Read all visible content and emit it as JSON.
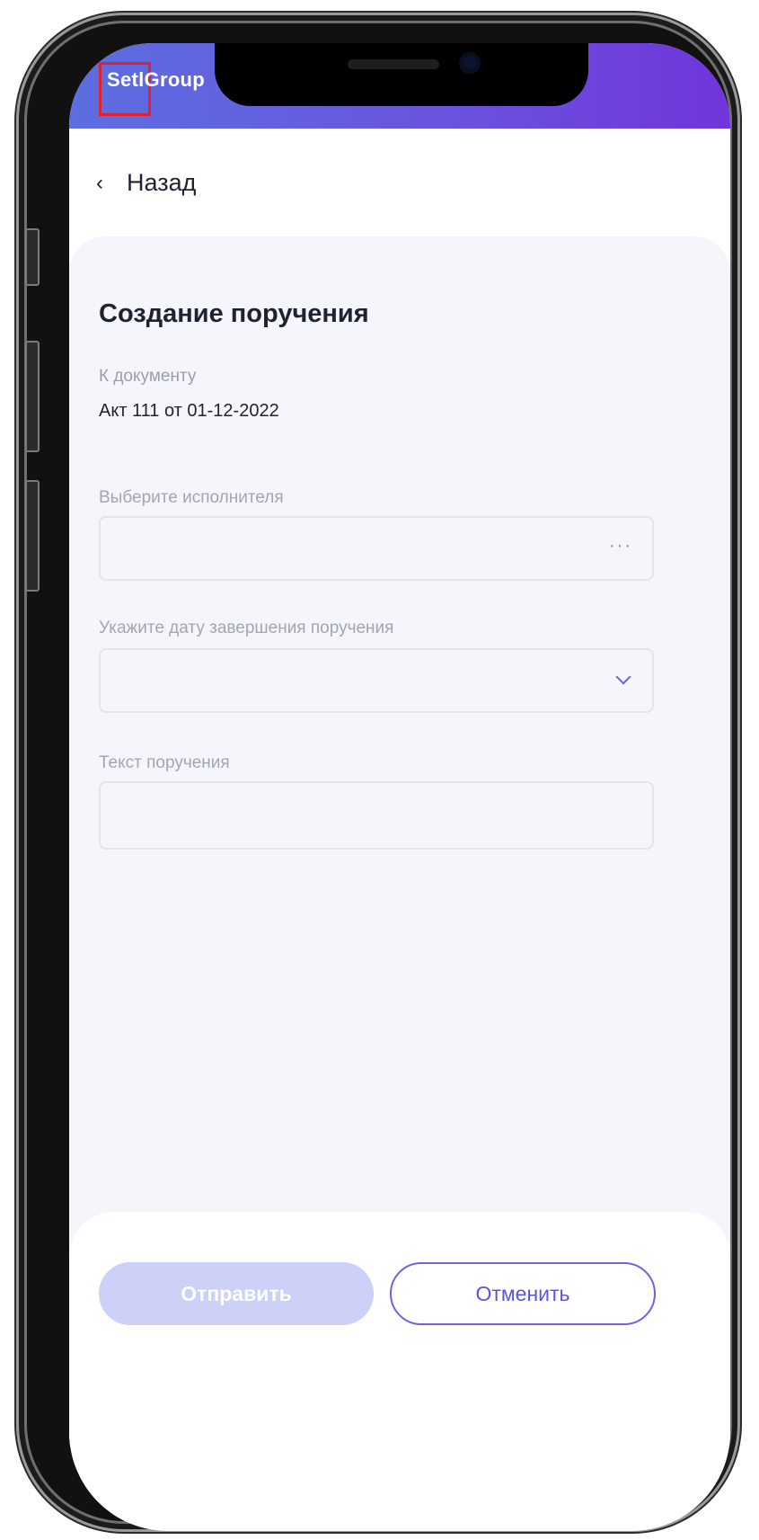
{
  "app": {
    "logo_text": "SetlGroup"
  },
  "nav": {
    "back_label": "Назад",
    "back_icon": "‹"
  },
  "form": {
    "title": "Создание поручения",
    "document": {
      "caption": "К документу",
      "value": "Акт 111 от 01-12-2022"
    },
    "executor": {
      "label": "Выберите исполнителя",
      "value": "",
      "action_icon": "···"
    },
    "due_date": {
      "label": "Укажите дату завершения поручения",
      "value": ""
    },
    "text": {
      "label": "Текст поручения",
      "value": ""
    }
  },
  "actions": {
    "send_label": "Отправить",
    "cancel_label": "Отменить"
  },
  "colors": {
    "accent": "#6a63e6",
    "header_start": "#5c6ee0",
    "header_end": "#7035dc",
    "disabled_button": "#cdd0f7"
  }
}
